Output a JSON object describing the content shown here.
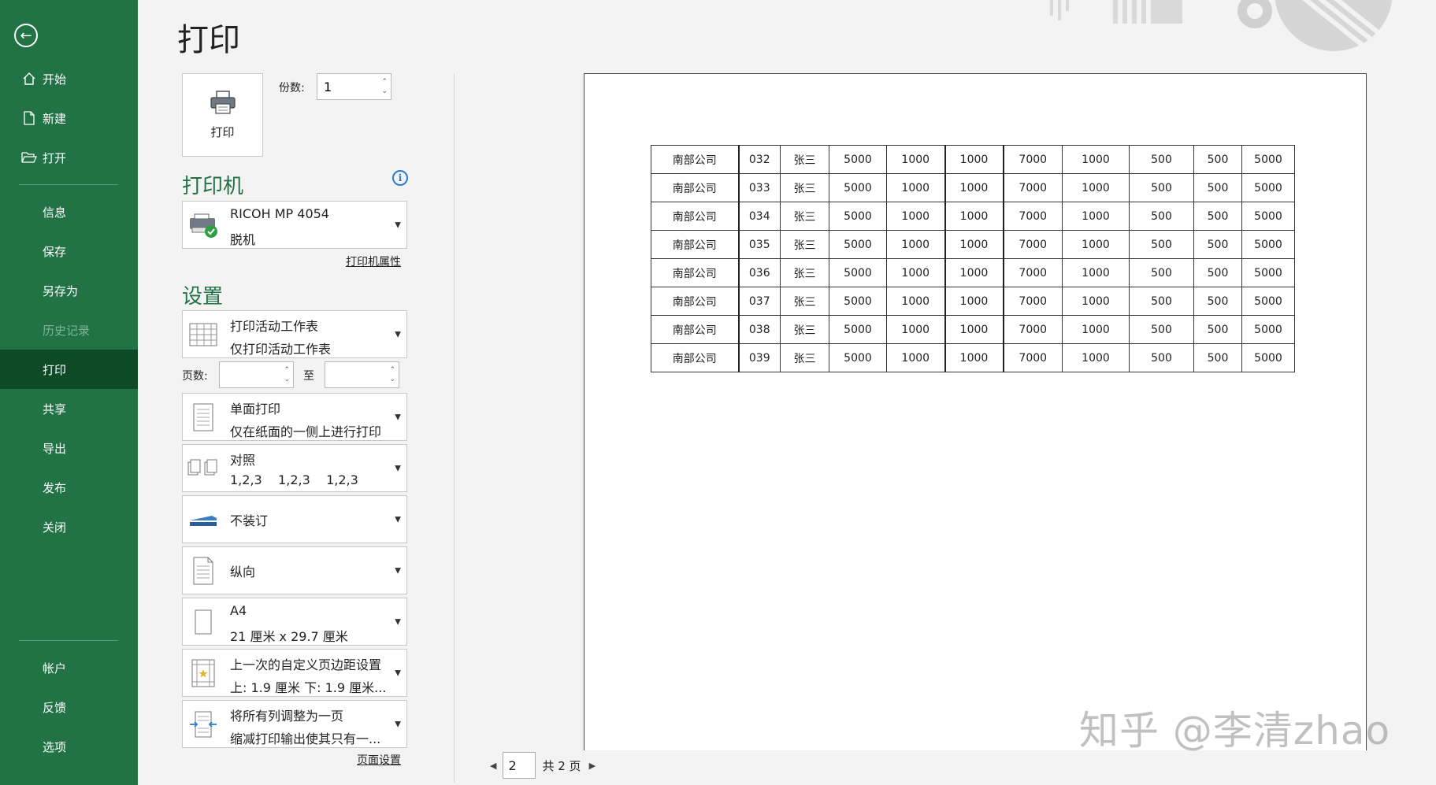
{
  "page_title": "打印",
  "sidebar": {
    "items": [
      {
        "label": "开始",
        "icon": "home-icon"
      },
      {
        "label": "新建",
        "icon": "new-document-icon"
      },
      {
        "label": "打开",
        "icon": "open-folder-icon"
      },
      {
        "label": "信息"
      },
      {
        "label": "保存"
      },
      {
        "label": "另存为"
      },
      {
        "label": "历史记录"
      },
      {
        "label": "打印"
      },
      {
        "label": "共享"
      },
      {
        "label": "导出"
      },
      {
        "label": "发布"
      },
      {
        "label": "关闭"
      },
      {
        "label": "帐户"
      },
      {
        "label": "反馈"
      },
      {
        "label": "选项"
      }
    ]
  },
  "print": {
    "button_label": "打印",
    "copies_label": "份数:",
    "copies_value": "1"
  },
  "printer": {
    "heading": "打印机",
    "name": "RICOH MP 4054",
    "status": "脱机",
    "properties_link": "打印机属性"
  },
  "settings": {
    "heading": "设置",
    "print_what": {
      "line1": "打印活动工作表",
      "line2": "仅打印活动工作表"
    },
    "pages_label": "页数:",
    "to_label": "至",
    "sides": {
      "line1": "单面打印",
      "line2": "仅在纸面的一侧上进行打印"
    },
    "collate": {
      "line1": "对照",
      "line2": "1,2,3    1,2,3    1,2,3"
    },
    "staple": "不装订",
    "orientation": "纵向",
    "paper": {
      "line1": "A4",
      "line2": "21 厘米 x 29.7 厘米"
    },
    "margins": {
      "line1": "上一次的自定义页边距设置",
      "line2": "上: 1.9 厘米 下: 1.9 厘米..."
    },
    "scaling": {
      "line1": "将所有列调整为一页",
      "line2": "缩减打印输出使其只有一..."
    },
    "page_setup_link": "页面设置"
  },
  "preview": {
    "rows": [
      [
        "南部公司",
        "032",
        "张三",
        "5000",
        "1000",
        "1000",
        "7000",
        "1000",
        "500",
        "500",
        "5000"
      ],
      [
        "南部公司",
        "033",
        "张三",
        "5000",
        "1000",
        "1000",
        "7000",
        "1000",
        "500",
        "500",
        "5000"
      ],
      [
        "南部公司",
        "034",
        "张三",
        "5000",
        "1000",
        "1000",
        "7000",
        "1000",
        "500",
        "500",
        "5000"
      ],
      [
        "南部公司",
        "035",
        "张三",
        "5000",
        "1000",
        "1000",
        "7000",
        "1000",
        "500",
        "500",
        "5000"
      ],
      [
        "南部公司",
        "036",
        "张三",
        "5000",
        "1000",
        "1000",
        "7000",
        "1000",
        "500",
        "500",
        "5000"
      ],
      [
        "南部公司",
        "037",
        "张三",
        "5000",
        "1000",
        "1000",
        "7000",
        "1000",
        "500",
        "500",
        "5000"
      ],
      [
        "南部公司",
        "038",
        "张三",
        "5000",
        "1000",
        "1000",
        "7000",
        "1000",
        "500",
        "500",
        "5000"
      ],
      [
        "南部公司",
        "039",
        "张三",
        "5000",
        "1000",
        "1000",
        "7000",
        "1000",
        "500",
        "500",
        "5000"
      ]
    ]
  },
  "pager": {
    "current": "2",
    "total": "共 2 页"
  },
  "watermark": "知乎 @李清zhao",
  "colors": {
    "sidebar": "#217346",
    "sidebar_active": "#0e4a26",
    "accent": "#217346"
  }
}
